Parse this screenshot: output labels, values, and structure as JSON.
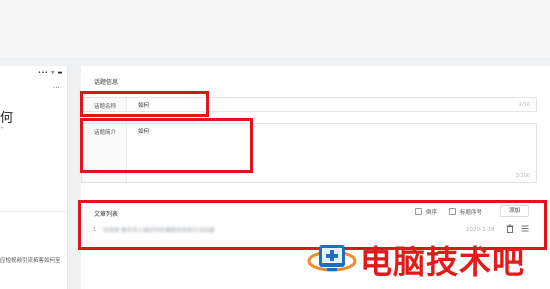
{
  "phone_preview": {
    "status": "••• ᯤ ▬",
    "more": "···",
    "title": "何",
    "subtitle": "+",
    "article_snippet": "应短视频引流拓客如何至"
  },
  "topic_info": {
    "section_title": "话题信息",
    "name_label": "话题名称",
    "name_value": "如何",
    "name_count": "2/16",
    "intro_label": "话题简介",
    "intro_value": "如何",
    "intro_count": "2/200"
  },
  "article_list": {
    "section_title": "文章列表",
    "reverse_order_label": "倒序",
    "heading_number_label": "标题序号",
    "add_button": "添加",
    "rows": [
      {
        "index": "1",
        "title": "短视频 教你怎么做好你的爆款短视频引流拓客",
        "date": "2020-3-18"
      }
    ]
  },
  "watermark": {
    "text": "电脑技术吧"
  },
  "colors": {
    "highlight": "#e0141d",
    "watermark": "#e11a1a"
  },
  "icons": {
    "delete": "trash-icon",
    "drag": "menu-icon"
  }
}
